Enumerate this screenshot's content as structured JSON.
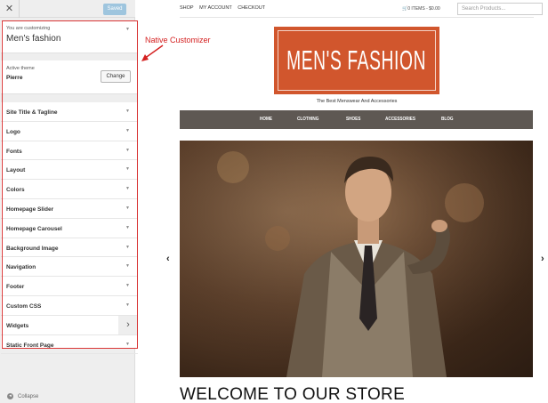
{
  "customizer": {
    "close_icon": "close-icon",
    "saved_label": "Saved",
    "customizing_label": "You are customizing",
    "site_name": "Men's fashion",
    "active_theme_label": "Active theme",
    "theme_name": "Pierre",
    "change_label": "Change",
    "sections": [
      {
        "label": "Site Title & Tagline"
      },
      {
        "label": "Logo"
      },
      {
        "label": "Fonts"
      },
      {
        "label": "Layout"
      },
      {
        "label": "Colors"
      },
      {
        "label": "Homepage Slider"
      },
      {
        "label": "Homepage Carousel"
      },
      {
        "label": "Background Image"
      },
      {
        "label": "Navigation"
      },
      {
        "label": "Footer"
      },
      {
        "label": "Custom CSS"
      },
      {
        "label": "Widgets"
      },
      {
        "label": "Static Front Page"
      }
    ],
    "collapse_label": "Collapse"
  },
  "annotation": {
    "text": "Native Customizer",
    "color": "#d42020"
  },
  "site": {
    "top_links": [
      "SHOP",
      "MY ACCOUNT",
      "CHECKOUT"
    ],
    "cart_text": "0 ITEMS - $0.00",
    "search_placeholder": "Search Products...",
    "logo_text": "MEN'S FASHION",
    "logo_color": "#d1562d",
    "tagline": "The Best Menswear And Accessories",
    "nav": [
      "HOME",
      "CLOTHING",
      "SHOES",
      "ACCESSORIES",
      "BLOG"
    ],
    "nav_color": "#5e5853",
    "prev_label": "‹",
    "next_label": "›",
    "welcome": "WELCOME TO OUR STORE"
  }
}
